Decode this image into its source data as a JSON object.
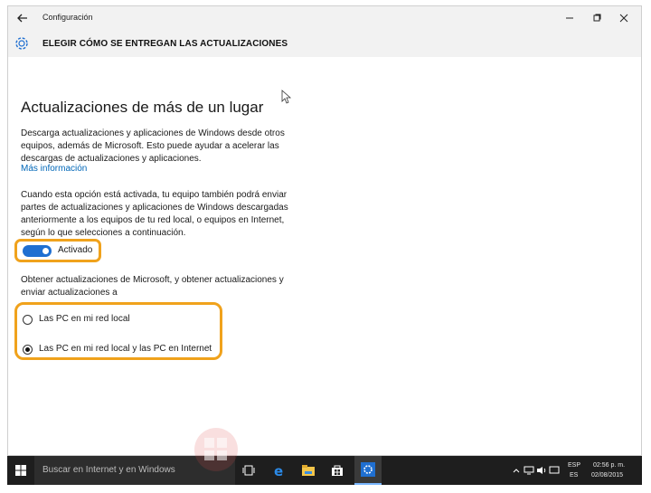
{
  "window": {
    "title": "Configuración",
    "back_icon": "back-arrow-icon",
    "minimize_icon": "minimize-icon",
    "maximize_icon": "maximize-icon",
    "close_icon": "close-icon"
  },
  "header": {
    "icon": "gear-icon",
    "title": "ELEGIR CÓMO SE ENTREGAN LAS ACTUALIZACIONES"
  },
  "main": {
    "heading": "Actualizaciones de más de un lugar",
    "description_lines": [
      "Descarga actualizaciones y aplicaciones de Windows desde otros",
      "equipos, además de Microsoft. Esto puede ayudar a acelerar las",
      "descargas de actualizaciones y aplicaciones."
    ],
    "more_info_link": "Más información",
    "explain_lines": [
      "Cuando esta opción está activada, tu equipo también podrá enviar",
      "partes de actualizaciones y aplicaciones de Windows descargadas",
      "anteriormente a los equipos de tu red local, o equipos en Internet,",
      "según lo que selecciones a continuación."
    ],
    "toggle": {
      "label": "Activado",
      "on": true
    },
    "obtain_lines": [
      "Obtener actualizaciones de Microsoft, y obtener actualizaciones y",
      "enviar actualizaciones a"
    ],
    "radio_options": [
      {
        "label": "Las PC en mi red local",
        "selected": false
      },
      {
        "label": "Las PC en mi red local y las PC en Internet",
        "selected": true
      }
    ]
  },
  "taskbar": {
    "search_placeholder": "Buscar en Internet y en Windows",
    "icons": [
      "windows-start-icon",
      "task-view-icon",
      "edge-icon",
      "file-explorer-icon",
      "store-icon",
      "settings-icon"
    ],
    "language_top": "ESP",
    "language_bottom": "ES",
    "time": "02:56 p. m.",
    "date": "02/08/2015"
  },
  "colors": {
    "accent": "#1f6fd1",
    "highlight": "#f0a21c",
    "link": "#0067b8",
    "taskbar": "#1e1e1e"
  }
}
